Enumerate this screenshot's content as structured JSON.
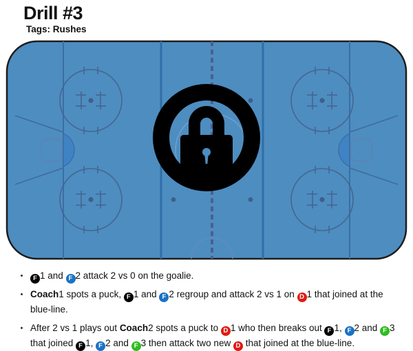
{
  "header": {
    "title": "Drill #3",
    "tags": "Tags: Rushes"
  },
  "rink": {
    "locked": true,
    "lock_icon": "lock-icon",
    "ice_color": "#4e8dc0",
    "line_color": "#2f6fa8",
    "mark_color": "#456592",
    "border_color": "#1d1d1d",
    "center_line_color": "#4a5f8f"
  },
  "instructions": [
    {
      "id": "step-1",
      "segments": [
        {
          "type": "badge",
          "team": "black",
          "letter": "F"
        },
        {
          "type": "text",
          "text": "1 and "
        },
        {
          "type": "badge",
          "team": "blue",
          "letter": "F"
        },
        {
          "type": "text",
          "text": "2 attack 2 vs 0 on the goalie."
        }
      ]
    },
    {
      "id": "step-2",
      "segments": [
        {
          "type": "bold",
          "text": "Coach"
        },
        {
          "type": "text",
          "text": "1 spots a puck, "
        },
        {
          "type": "badge",
          "team": "black",
          "letter": "F"
        },
        {
          "type": "text",
          "text": "1 and "
        },
        {
          "type": "badge",
          "team": "blue",
          "letter": "F"
        },
        {
          "type": "text",
          "text": "2 regroup and attack 2 vs 1 on "
        },
        {
          "type": "badge",
          "team": "red",
          "letter": "D"
        },
        {
          "type": "text",
          "text": "1 that joined at the blue-line."
        }
      ]
    },
    {
      "id": "step-3",
      "segments": [
        {
          "type": "text",
          "text": "After 2 vs 1 plays out "
        },
        {
          "type": "bold",
          "text": "Coach"
        },
        {
          "type": "text",
          "text": "2 spots a puck to "
        },
        {
          "type": "badge",
          "team": "red",
          "letter": "D"
        },
        {
          "type": "text",
          "text": "1 who then breaks out "
        },
        {
          "type": "badge",
          "team": "black",
          "letter": "F"
        },
        {
          "type": "text",
          "text": "1, "
        },
        {
          "type": "badge",
          "team": "blue",
          "letter": "F"
        },
        {
          "type": "text",
          "text": "2 and "
        },
        {
          "type": "badge",
          "team": "green",
          "letter": "F"
        },
        {
          "type": "text",
          "text": "3 that joined "
        },
        {
          "type": "badge",
          "team": "black",
          "letter": "F"
        },
        {
          "type": "text",
          "text": "1, "
        },
        {
          "type": "badge",
          "team": "blue",
          "letter": "F"
        },
        {
          "type": "text",
          "text": "2 and "
        },
        {
          "type": "badge",
          "team": "green",
          "letter": "F"
        },
        {
          "type": "text",
          "text": "3  then attack two new "
        },
        {
          "type": "badge",
          "team": "red",
          "letter": "D"
        },
        {
          "type": "text",
          "text": " that joined at the blue-line."
        }
      ]
    }
  ],
  "colors": {
    "black_team": "#000000",
    "blue_team": "#1a72c4",
    "red_team": "#e01b10",
    "green_team": "#2fbd1f"
  }
}
